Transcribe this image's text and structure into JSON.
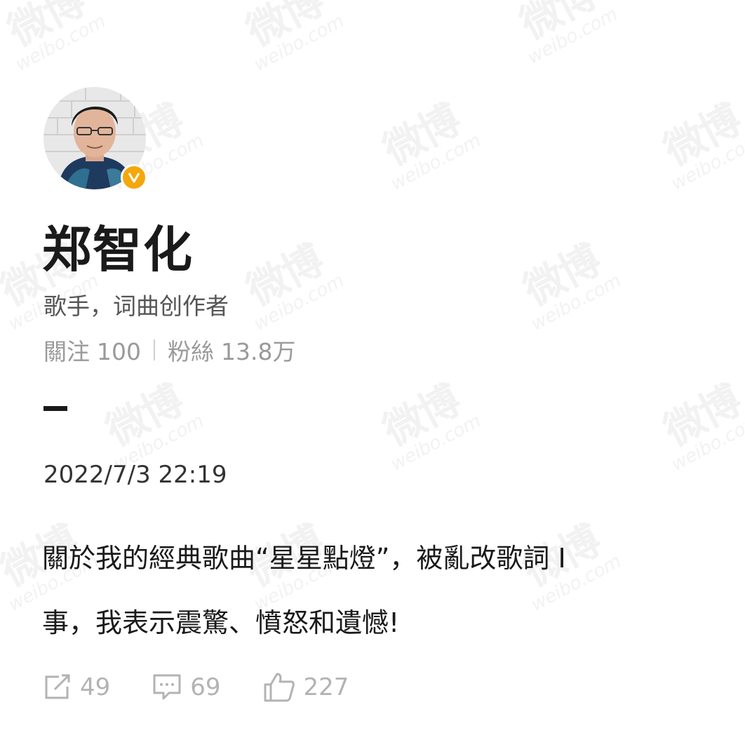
{
  "profile": {
    "name": "郑智化",
    "bio": "歌手，词曲创作者",
    "following_label": "關注",
    "following_count": "100",
    "followers_label": "粉絲",
    "followers_count": "13.8万",
    "verified_color": "#f5a70b"
  },
  "post": {
    "timestamp": "2022/7/3 22:19",
    "line1": "關於我的經典歌曲“星星點燈”，被亂改歌詞 I",
    "line2": "事，我表示震驚、憤怒和遺憾!"
  },
  "actions": {
    "repost_count": "49",
    "comment_count": "69",
    "like_count": "227"
  },
  "watermark": {
    "big": "微博",
    "small": "weibo.com"
  }
}
